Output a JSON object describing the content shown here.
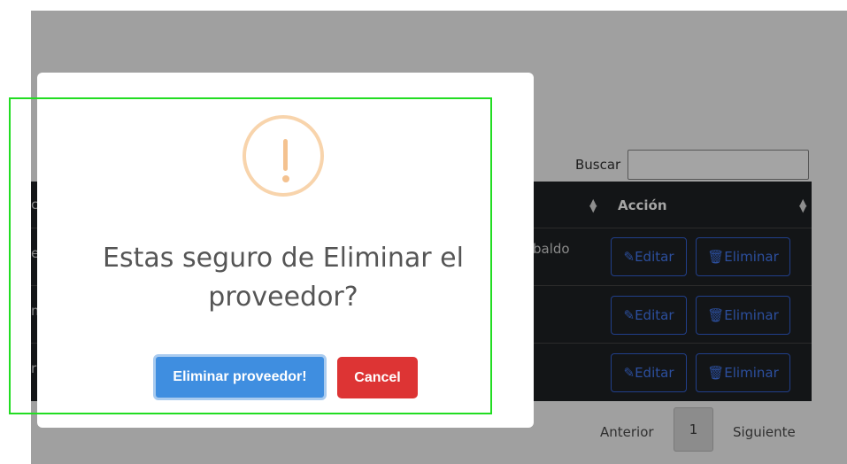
{
  "search": {
    "label": "Buscar",
    "value": ""
  },
  "table": {
    "header_action": "Acción",
    "sort_icon": "sort-icon",
    "rows": [
      {
        "text_fragment": "baldo",
        "edit_label": "Editar",
        "delete_label": "Eliminar"
      },
      {
        "text_fragment": "",
        "edit_label": "Editar",
        "delete_label": "Eliminar"
      },
      {
        "text_fragment": "",
        "edit_label": "Editar",
        "delete_label": "Eliminar"
      }
    ],
    "left_edge_glyphs": [
      "c",
      "e",
      "m",
      "r"
    ]
  },
  "pagination": {
    "prev": "Anterior",
    "current": "1",
    "next": "Siguiente"
  },
  "modal": {
    "icon": "warning-icon",
    "title": "Estas seguro de Eliminar el proveedor?",
    "confirm_label": "Eliminar proveedor!",
    "cancel_label": "Cancel"
  },
  "colors": {
    "overlay": "#a0a0a0",
    "table_bg": "#131517",
    "confirm": "#3f8ee0",
    "cancel": "#dd3434",
    "warning": "#f8d4ac",
    "focus_outline": "#22dd22"
  }
}
